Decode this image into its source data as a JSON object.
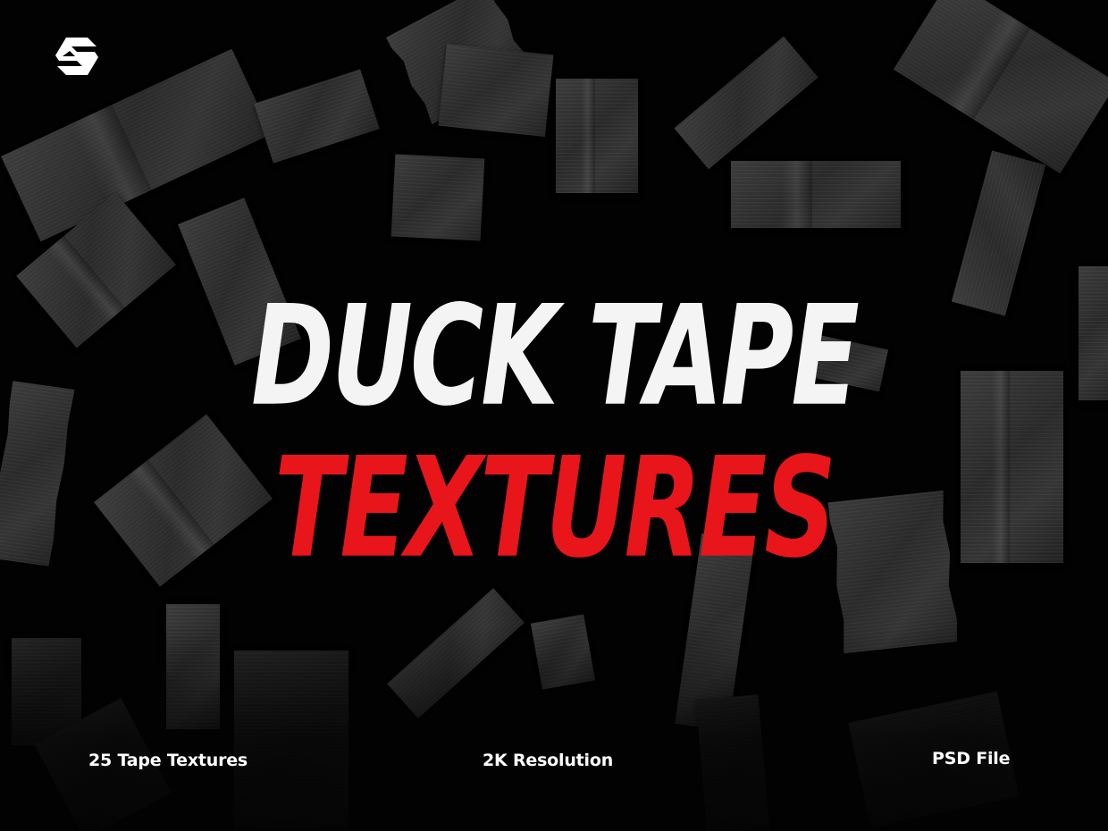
{
  "brand": {
    "logo_icon": "stylized-s-logo-icon"
  },
  "title": {
    "line1": "DUCK TAPE",
    "line2": "TEXTURES"
  },
  "features": [
    "25 Tape Textures",
    "2K Resolution",
    "PSD File"
  ],
  "colors": {
    "background": "#020202",
    "title_primary": "#f4f4f4",
    "title_accent": "#e8151b",
    "feature_text": "#ffffff",
    "tape": "#333333"
  }
}
